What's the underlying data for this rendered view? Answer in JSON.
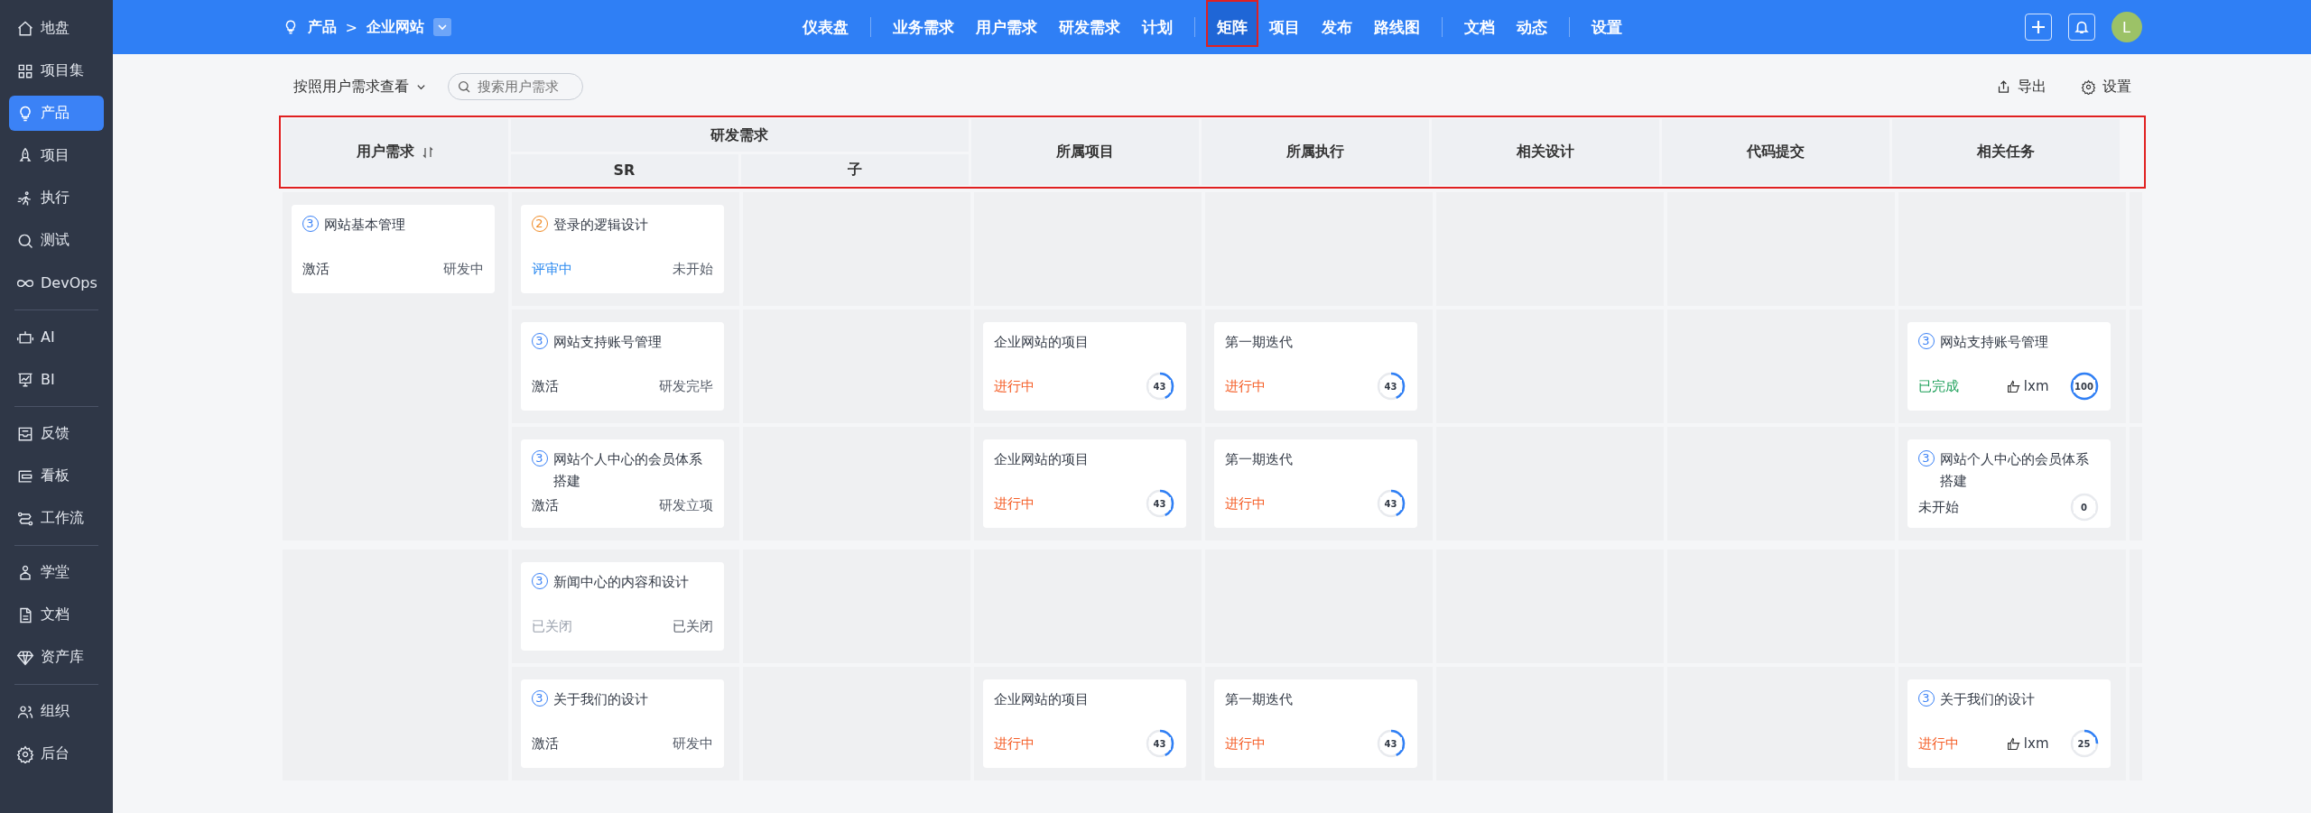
{
  "sidebar": {
    "groups": [
      [
        {
          "label": "地盘",
          "selected": false
        },
        {
          "label": "项目集",
          "selected": false
        },
        {
          "label": "产品",
          "selected": true
        },
        {
          "label": "项目",
          "selected": false
        },
        {
          "label": "执行",
          "selected": false
        },
        {
          "label": "测试",
          "selected": false
        },
        {
          "label": "DevOps",
          "selected": false
        }
      ],
      [
        {
          "label": "AI",
          "selected": false
        },
        {
          "label": "BI",
          "selected": false
        }
      ],
      [
        {
          "label": "反馈",
          "selected": false
        },
        {
          "label": "看板",
          "selected": false
        },
        {
          "label": "工作流",
          "selected": false
        }
      ],
      [
        {
          "label": "学堂",
          "selected": false
        },
        {
          "label": "文档",
          "selected": false
        },
        {
          "label": "资产库",
          "selected": false
        }
      ],
      [
        {
          "label": "组织",
          "selected": false
        },
        {
          "label": "后台",
          "selected": false
        }
      ]
    ]
  },
  "topbar": {
    "breadcrumb": {
      "section": "产品",
      "separator": ">",
      "product": "企业网站"
    },
    "nav_groups": [
      [
        {
          "label": "仪表盘",
          "selected": false,
          "highlighted": false
        }
      ],
      [
        {
          "label": "业务需求",
          "selected": false,
          "highlighted": false
        },
        {
          "label": "用户需求",
          "selected": false,
          "highlighted": false
        },
        {
          "label": "研发需求",
          "selected": false,
          "highlighted": false
        },
        {
          "label": "计划",
          "selected": false,
          "highlighted": false
        }
      ],
      [
        {
          "label": "矩阵",
          "selected": true,
          "highlighted": true
        },
        {
          "label": "项目",
          "selected": false,
          "highlighted": false
        },
        {
          "label": "发布",
          "selected": false,
          "highlighted": false
        },
        {
          "label": "路线图",
          "selected": false,
          "highlighted": false
        }
      ],
      [
        {
          "label": "文档",
          "selected": false,
          "highlighted": false
        },
        {
          "label": "动态",
          "selected": false,
          "highlighted": false
        }
      ],
      [
        {
          "label": "设置",
          "selected": false,
          "highlighted": false
        }
      ]
    ],
    "avatar": "L"
  },
  "toolbar": {
    "view": "按照用户需求查看",
    "search": {
      "placeholder": "搜索用户需求"
    },
    "export": "导出",
    "settings": "设置"
  },
  "table": {
    "highlighted": true,
    "columns": {
      "story": "用户需求",
      "dev": "研发需求",
      "sr": "SR",
      "child": "子",
      "project": "所属项目",
      "execution": "所属执行",
      "design": "相关设计",
      "code": "代码提交",
      "task": "相关任务"
    },
    "groups": [
      {
        "story": {
          "pri": "3",
          "title": "网站基本管理",
          "status": "激活",
          "color": "#333a46",
          "stage": "研发中"
        },
        "rows": [
          {
            "sr": {
              "pri": "2",
              "title": "登录的逻辑设计",
              "status": "评审中",
              "color": "#2e8bf0",
              "stage": "未开始"
            }
          },
          {
            "sr": {
              "pri": "3",
              "title": "网站支持账号管理",
              "status": "激活",
              "color": "#333a46",
              "stage": "研发完毕"
            },
            "project": {
              "name": "企业网站的项目",
              "status": "进行中",
              "color": "#f5602a",
              "progress": "43",
              "level": 0.43
            },
            "execution": {
              "name": "第一期迭代",
              "status": "进行中",
              "color": "#f5602a",
              "progress": "43",
              "level": 0.43
            },
            "task": {
              "pri": "3",
              "title": "网站支持账号管理",
              "status": "已完成",
              "color": "#1ea05a",
              "assignee": "lxm",
              "progress": "100",
              "level": 1
            }
          },
          {
            "sr": {
              "pri": "3",
              "title": "网站个人中心的会员体系搭建",
              "status": "激活",
              "color": "#333a46",
              "stage": "研发立项"
            },
            "project": {
              "name": "企业网站的项目",
              "status": "进行中",
              "color": "#f5602a",
              "progress": "43",
              "level": 0.43
            },
            "execution": {
              "name": "第一期迭代",
              "status": "进行中",
              "color": "#f5602a",
              "progress": "43",
              "level": 0.43
            },
            "task": {
              "pri": "3",
              "title": "网站个人中心的会员体系搭建",
              "status": "未开始",
              "color": "#333a46",
              "progress": "0",
              "level": 0
            }
          }
        ]
      },
      {
        "rows": [
          {
            "sr": {
              "pri": "3",
              "title": "新闻中心的内容和设计",
              "status": "已关闭",
              "color": "#9aa1ad",
              "stage": "已关闭"
            }
          },
          {
            "sr": {
              "pri": "3",
              "title": "关于我们的设计",
              "status": "激活",
              "color": "#333a46",
              "stage": "研发中"
            },
            "project": {
              "name": "企业网站的项目",
              "status": "进行中",
              "color": "#f5602a",
              "progress": "43",
              "level": 0.43
            },
            "execution": {
              "name": "第一期迭代",
              "status": "进行中",
              "color": "#f5602a",
              "progress": "43",
              "level": 0.43
            },
            "task": {
              "pri": "3",
              "title": "关于我们的设计",
              "status": "进行中",
              "color": "#f5602a",
              "assignee": "lxm",
              "progress": "25",
              "level": 0.25
            }
          }
        ]
      }
    ]
  }
}
